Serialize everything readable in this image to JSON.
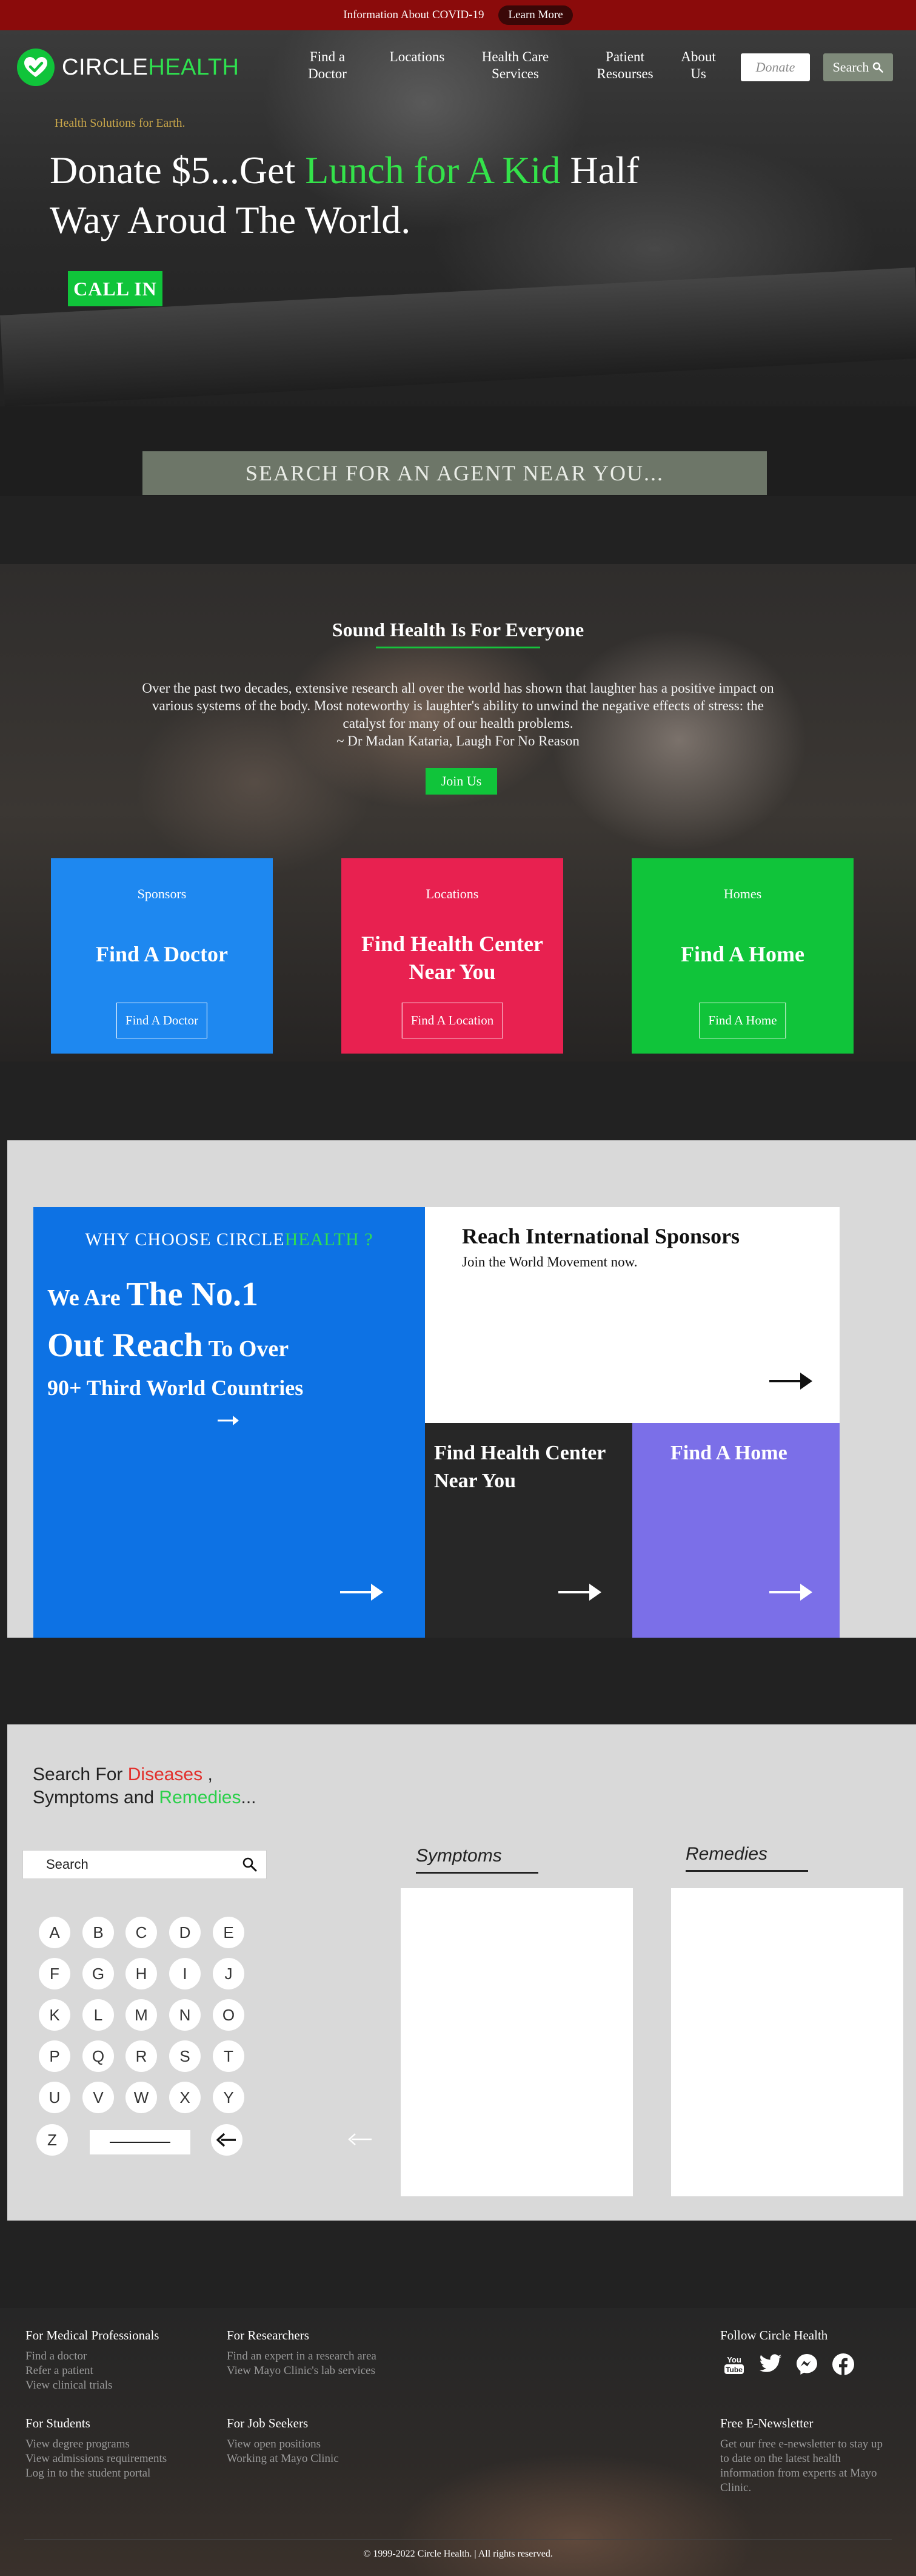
{
  "topbar": {
    "info": "Information About COVID-19",
    "learn_more": "Learn More"
  },
  "brand": {
    "name_part1": "CIRCLE",
    "name_part2": "HEALTH",
    "accent": "#2fe04f"
  },
  "nav": {
    "items": [
      {
        "line1": "Find a",
        "line2": "Doctor"
      },
      {
        "line1": "Locations",
        "line2": ""
      },
      {
        "line1": "Health Care",
        "line2": "Services"
      },
      {
        "line1": "Patient",
        "line2": "Resourses"
      },
      {
        "line1": "About",
        "line2": "Us"
      }
    ],
    "donate": "Donate",
    "search": "Search"
  },
  "hero": {
    "tagline": "Health Solutions for Earth.",
    "headline_part1": "Donate $5...Get ",
    "headline_highlight": "Lunch for A Kid",
    "headline_part2": " Half Way Aroud The World.",
    "call_in": "CALL IN",
    "agent_search": "SEARCH FOR AN AGENT NEAR YOU..."
  },
  "sound": {
    "title": "Sound Health Is For Everyone",
    "quote": "Over the past two decades, extensive research all over the world has shown that laughter has a positive impact on various systems of the body. Most noteworthy is laughter's ability to unwind the negative effects of stress: the catalyst for many of our health problems.",
    "attribution": "~ Dr Madan Kataria, Laugh For No Reason",
    "join": "Join Us",
    "cards": [
      {
        "category": "Sponsors",
        "title": "Find A Doctor",
        "button": "Find A Doctor",
        "color": "#1e88f0"
      },
      {
        "category": "Locations",
        "title": "Find Health Center Near You",
        "button": "Find A Location",
        "color": "#e82150"
      },
      {
        "category": "Homes",
        "title": "Find A Home",
        "button": "Find A Home",
        "color": "#10c43a"
      }
    ]
  },
  "why": {
    "heading_part1": "WHY CHOOSE CIRCLE",
    "heading_part2": "HEALTH ?",
    "line1_small": "We Are ",
    "line1_big": "The No.1",
    "line2_big": "Out Reach",
    "line2_small": " To Over",
    "line3": "90+ Third World Countries",
    "reach_title": "Reach International Sponsors",
    "reach_sub": "Join the World Movement now.",
    "health_title": "Find Health Center Near You",
    "home_title": "Find A Home"
  },
  "search": {
    "title_prefix": "Search For ",
    "title_diseases": "Diseases",
    "title_mid": " ,",
    "title_line2_prefix": "Symptoms and ",
    "title_remedies": "Remedies",
    "title_suffix": "...",
    "placeholder": "Search",
    "letters": [
      "A",
      "B",
      "C",
      "D",
      "E",
      "F",
      "G",
      "H",
      "I",
      "J",
      "K",
      "L",
      "M",
      "N",
      "O",
      "P",
      "Q",
      "R",
      "S",
      "T",
      "U",
      "V",
      "W",
      "X",
      "Y",
      "Z"
    ],
    "symptoms_label": "Symptoms",
    "remedies_label": "Remedies"
  },
  "footer": {
    "medical": {
      "heading": "For Medical Professionals",
      "links": [
        "Find a doctor",
        "Refer a patient",
        "View clinical trials"
      ]
    },
    "researchers": {
      "heading": "For Researchers",
      "links": [
        "Find an expert in a research area",
        "View Mayo Clinic's lab services"
      ]
    },
    "students": {
      "heading": "For Students",
      "links": [
        "View degree programs",
        "View admissions requirements",
        "Log in to the student portal"
      ]
    },
    "jobseekers": {
      "heading": "For Job Seekers",
      "links": [
        "View open positions",
        "Working at Mayo Clinic"
      ]
    },
    "follow": "Follow Circle Health",
    "social_icons": [
      "youtube-icon",
      "twitter-icon",
      "messenger-icon",
      "facebook-icon"
    ],
    "newsletter_heading": "Free E-Newsletter",
    "newsletter_text": "Get our free e-newsletter to stay up to date on the latest health information from experts at Mayo Clinic.",
    "copyright": "© 1999-2022 Circle Health. | All rights reserved."
  }
}
